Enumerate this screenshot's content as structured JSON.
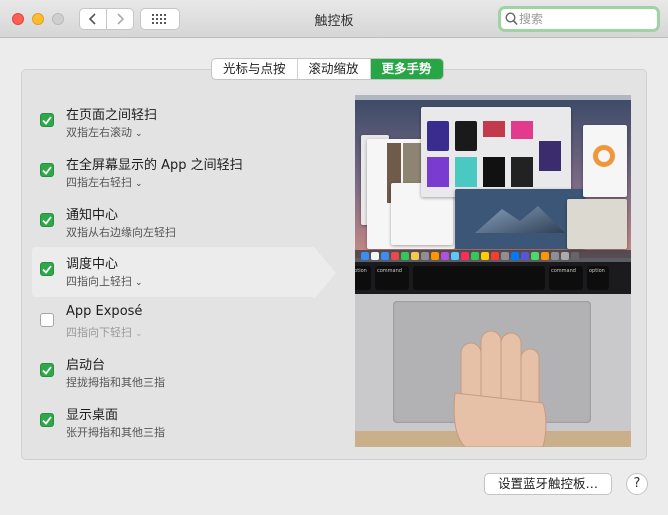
{
  "window": {
    "title": "触控板"
  },
  "toolbar": {
    "back_icon": "chevron-left-icon",
    "forward_icon": "chevron-right-icon",
    "grid_icon": "show-all-grid-icon"
  },
  "search": {
    "placeholder": "搜索",
    "value": ""
  },
  "tabs": [
    {
      "label": "光标与点按",
      "active": false
    },
    {
      "label": "滚动缩放",
      "active": false
    },
    {
      "label": "更多手势",
      "active": true
    }
  ],
  "gestures": [
    {
      "title": "在页面之间轻扫",
      "option": "双指左右滚动",
      "checked": true,
      "selected": false,
      "disabled": false
    },
    {
      "title": "在全屏幕显示的 App 之间轻扫",
      "option": "四指左右轻扫",
      "checked": true,
      "selected": false,
      "disabled": false
    },
    {
      "title": "通知中心",
      "option": "双指从右边缘向左轻扫",
      "checked": true,
      "selected": false,
      "disabled": false
    },
    {
      "title": "调度中心",
      "option": "四指向上轻扫",
      "checked": true,
      "selected": true,
      "disabled": false
    },
    {
      "title": "App Exposé",
      "option": "四指向下轻扫",
      "checked": false,
      "selected": false,
      "disabled": false
    },
    {
      "title": "启动台",
      "option": "捏拢拇指和其他三指",
      "checked": true,
      "selected": false,
      "disabled": false
    },
    {
      "title": "显示桌面",
      "option": "张开拇指和其他三指",
      "checked": true,
      "selected": false,
      "disabled": false
    }
  ],
  "preview": {
    "keys": [
      "option",
      "command",
      "command",
      "option"
    ]
  },
  "footer": {
    "bluetooth_button": "设置蓝牙触控板…",
    "help_button": "?"
  },
  "colors": {
    "accent": "#27a645",
    "checkbox": "#2ea84b",
    "search_focus": "#9fd3a1"
  }
}
